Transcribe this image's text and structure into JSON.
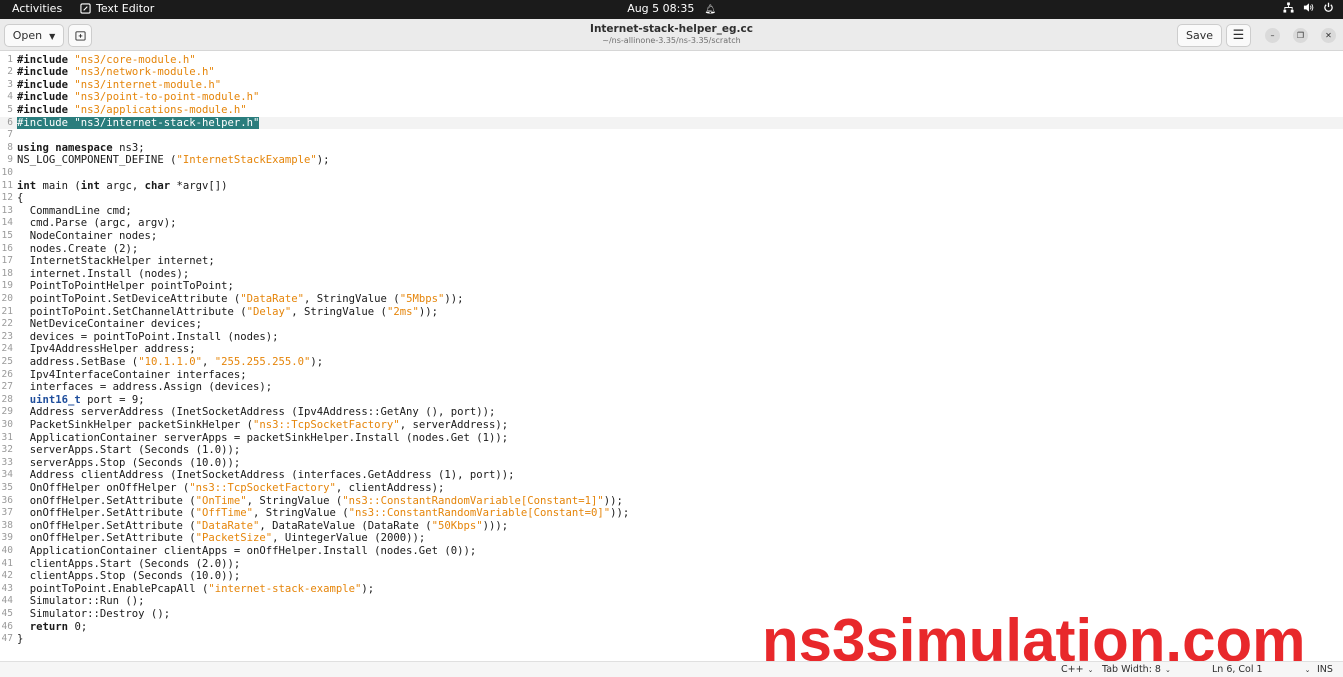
{
  "topbar": {
    "activities": "Activities",
    "app_name": "Text Editor",
    "clock": "Aug 5  08:35",
    "tray": {
      "network_icon": "network-icon",
      "volume_icon": "volume-icon",
      "power_icon": "power-icon"
    }
  },
  "header": {
    "open_label": "Open",
    "title": "Internet-stack-helper_eg.cc",
    "path": "~/ns-allinone-3.35/ns-3.35/scratch",
    "save_label": "Save"
  },
  "editor": {
    "current_line": 6,
    "lines": [
      "#include \"ns3/core-module.h\"",
      "#include \"ns3/network-module.h\"",
      "#include \"ns3/internet-module.h\"",
      "#include \"ns3/point-to-point-module.h\"",
      "#include \"ns3/applications-module.h\"",
      "#include \"ns3/internet-stack-helper.h\"",
      "",
      "using namespace ns3;",
      "NS_LOG_COMPONENT_DEFINE (\"InternetStackExample\");",
      "",
      "int main (int argc, char *argv[])",
      "{",
      "  CommandLine cmd;",
      "  cmd.Parse (argc, argv);",
      "  NodeContainer nodes;",
      "  nodes.Create (2);",
      "  InternetStackHelper internet;",
      "  internet.Install (nodes);",
      "  PointToPointHelper pointToPoint;",
      "  pointToPoint.SetDeviceAttribute (\"DataRate\", StringValue (\"5Mbps\"));",
      "  pointToPoint.SetChannelAttribute (\"Delay\", StringValue (\"2ms\"));",
      "  NetDeviceContainer devices;",
      "  devices = pointToPoint.Install (nodes);",
      "  Ipv4AddressHelper address;",
      "  address.SetBase (\"10.1.1.0\", \"255.255.255.0\");",
      "  Ipv4InterfaceContainer interfaces;",
      "  interfaces = address.Assign (devices);",
      "  uint16_t port = 9;",
      "  Address serverAddress (InetSocketAddress (Ipv4Address::GetAny (), port));",
      "  PacketSinkHelper packetSinkHelper (\"ns3::TcpSocketFactory\", serverAddress);",
      "  ApplicationContainer serverApps = packetSinkHelper.Install (nodes.Get (1));",
      "  serverApps.Start (Seconds (1.0));",
      "  serverApps.Stop (Seconds (10.0));",
      "  Address clientAddress (InetSocketAddress (interfaces.GetAddress (1), port));",
      "  OnOffHelper onOffHelper (\"ns3::TcpSocketFactory\", clientAddress);",
      "  onOffHelper.SetAttribute (\"OnTime\", StringValue (\"ns3::ConstantRandomVariable[Constant=1]\"));",
      "  onOffHelper.SetAttribute (\"OffTime\", StringValue (\"ns3::ConstantRandomVariable[Constant=0]\"));",
      "  onOffHelper.SetAttribute (\"DataRate\", DataRateValue (DataRate (\"50Kbps\")));",
      "  onOffHelper.SetAttribute (\"PacketSize\", UintegerValue (2000));",
      "  ApplicationContainer clientApps = onOffHelper.Install (nodes.Get (0));",
      "  clientApps.Start (Seconds (2.0));",
      "  clientApps.Stop (Seconds (10.0));",
      "  pointToPoint.EnablePcapAll (\"internet-stack-example\");",
      "  Simulator::Run ();",
      "  Simulator::Destroy ();",
      "  return 0;",
      "}"
    ]
  },
  "watermark": "ns3simulation.com",
  "statusbar": {
    "language": "C++",
    "tab_width": "Tab Width: 8",
    "position": "Ln 6, Col 1",
    "mode": "INS"
  },
  "colors": {
    "string": "#e5850a",
    "type": "#1f4e9c",
    "selection": "#2a7d7d",
    "watermark": "#e8282b"
  }
}
